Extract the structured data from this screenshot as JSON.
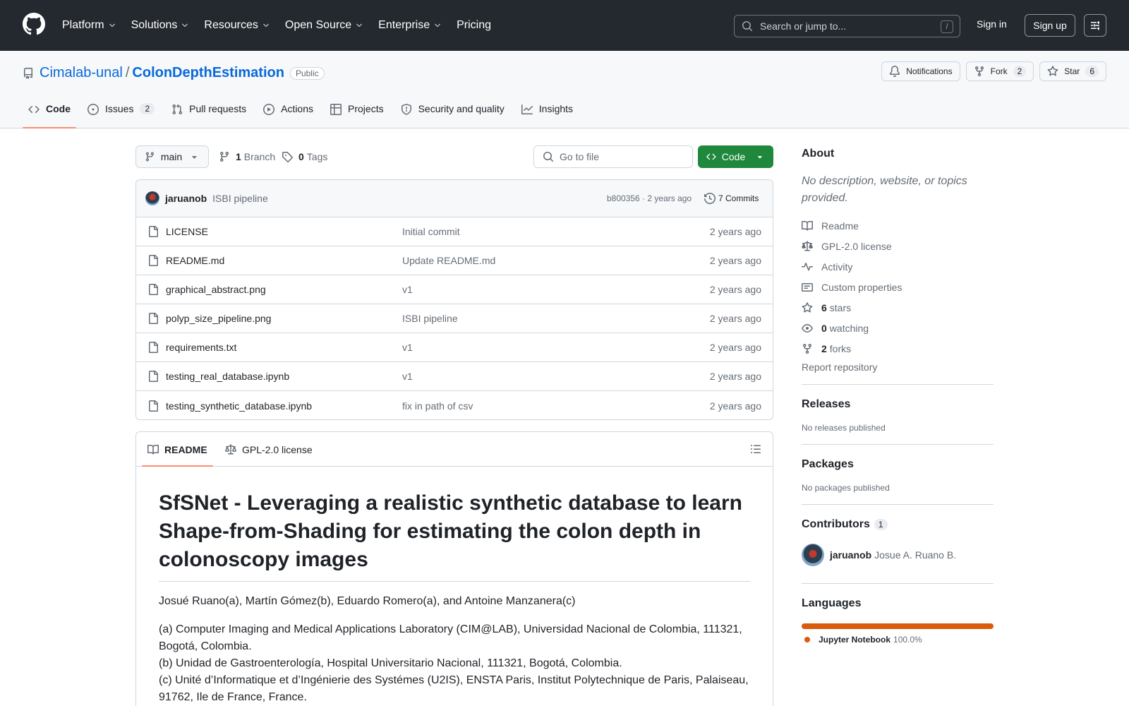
{
  "header": {
    "nav": [
      "Platform",
      "Solutions",
      "Resources",
      "Open Source",
      "Enterprise",
      "Pricing"
    ],
    "search_placeholder": "Search or jump to...",
    "search_shortcut": "/",
    "sign_in": "Sign in",
    "sign_up": "Sign up"
  },
  "repo": {
    "owner": "Cimalab-unal",
    "separator": "/",
    "name": "ColonDepthEstimation",
    "visibility": "Public",
    "notifications_label": "Notifications",
    "fork_label": "Fork",
    "fork_count": "2",
    "star_label": "Star",
    "star_count": "6",
    "tabs": [
      {
        "label": "Code",
        "icon": "code-icon"
      },
      {
        "label": "Issues",
        "icon": "issue-icon",
        "count": "2"
      },
      {
        "label": "Pull requests",
        "icon": "pull-request-icon"
      },
      {
        "label": "Actions",
        "icon": "play-icon"
      },
      {
        "label": "Projects",
        "icon": "table-icon"
      },
      {
        "label": "Security and quality",
        "icon": "shield-icon"
      },
      {
        "label": "Insights",
        "icon": "graph-icon"
      }
    ]
  },
  "toolbar": {
    "branch": "main",
    "branch_count": "1",
    "branch_label": "Branch",
    "tag_count": "0",
    "tag_label": "Tags",
    "goto_placeholder": "Go to file",
    "code_label": "Code"
  },
  "commit": {
    "author": "jaruanob",
    "message": "ISBI pipeline",
    "sha_time": "b800356 · 2 years ago",
    "commits_label": "7 Commits"
  },
  "files": [
    {
      "name": "LICENSE",
      "message": "Initial commit",
      "age": "2 years ago"
    },
    {
      "name": "README.md",
      "message": "Update README.md",
      "age": "2 years ago"
    },
    {
      "name": "graphical_abstract.png",
      "message": "v1",
      "age": "2 years ago"
    },
    {
      "name": "polyp_size_pipeline.png",
      "message": "ISBI pipeline",
      "age": "2 years ago"
    },
    {
      "name": "requirements.txt",
      "message": "v1",
      "age": "2 years ago"
    },
    {
      "name": "testing_real_database.ipynb",
      "message": "v1",
      "age": "2 years ago"
    },
    {
      "name": "testing_synthetic_database.ipynb",
      "message": "fix in path of csv",
      "age": "2 years ago"
    }
  ],
  "readme": {
    "tab_readme": "README",
    "tab_license": "GPL-2.0 license",
    "title": "SfSNet - Leveraging a realistic synthetic database to learn Shape-from-Shading for estimating the colon depth in colonoscopy images",
    "authors": "Josué Ruano(a), Martín Gómez(b), Eduardo Romero(a), and Antoine Manzanera(c)",
    "aff_a": "(a) Computer Imaging and Medical Applications Laboratory (CIM@LAB), Universidad Nacional de Colombia, 111321, Bogotá, Colombia.",
    "aff_b": "(b) Unidad de Gastroenterología, Hospital Universitario Nacional, 111321, Bogotá, Colombia.",
    "aff_c": "(c) Unité d’Informatique et d’Ingénierie des Systémes (U2IS), ENSTA Paris, Institut Polytechnique de Paris, Palaiseau, 91762, Ile de France, France."
  },
  "sidebar": {
    "about_title": "About",
    "about_desc": "No description, website, or topics provided.",
    "readme": "Readme",
    "license": "GPL-2.0 license",
    "activity": "Activity",
    "custom_properties": "Custom properties",
    "stars_count": "6",
    "stars_label": "stars",
    "watching_count": "0",
    "watching_label": "watching",
    "forks_count": "2",
    "forks_label": "forks",
    "report": "Report repository",
    "releases_title": "Releases",
    "releases_text": "No releases published",
    "packages_title": "Packages",
    "packages_text": "No packages published",
    "contributors_title": "Contributors",
    "contributors_count": "1",
    "contributor_login": "jaruanob",
    "contributor_name": "Josue A. Ruano B.",
    "languages_title": "Languages",
    "language_name": "Jupyter Notebook",
    "language_pct": "100.0%",
    "language_color": "#da5b0b"
  }
}
